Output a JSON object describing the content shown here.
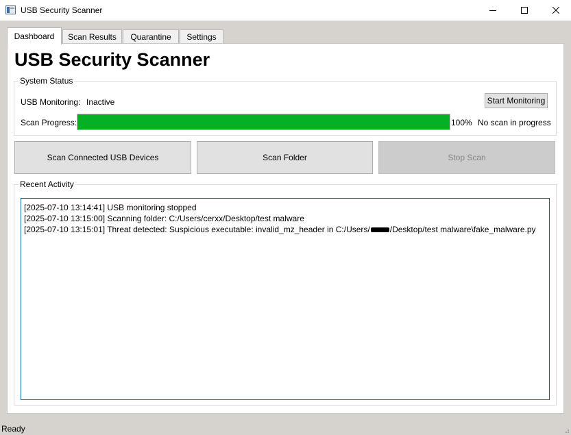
{
  "window": {
    "title": "USB Security Scanner"
  },
  "tabs": [
    {
      "label": "Dashboard",
      "active": true
    },
    {
      "label": "Scan Results",
      "active": false
    },
    {
      "label": "Quarantine",
      "active": false
    },
    {
      "label": "Settings",
      "active": false
    }
  ],
  "dashboard": {
    "heading": "USB Security Scanner",
    "system_status": {
      "title": "System Status",
      "monitoring_label": "USB Monitoring:",
      "monitoring_value": "Inactive",
      "start_button": "Start Monitoring",
      "progress_label": "Scan Progress:",
      "progress_percent": 100,
      "progress_text": "100%",
      "progress_status": "No scan in progress"
    },
    "actions": {
      "scan_usb": "Scan Connected USB Devices",
      "scan_folder": "Scan Folder",
      "stop_scan": "Stop Scan",
      "stop_enabled": false
    },
    "recent_activity": {
      "title": "Recent Activity",
      "lines": [
        "[2025-07-10 13:14:41] USB monitoring stopped",
        "[2025-07-10 13:15:00] Scanning folder: C:/Users/cerxx/Desktop/test malware",
        {
          "before": "[2025-07-10 13:15:01] Threat detected: Suspicious executable: invalid_mz_header in C:/Users/",
          "after": "/Desktop/test malware\\fake_malware.py"
        }
      ]
    }
  },
  "statusbar": {
    "text": "Ready"
  },
  "colors": {
    "progress_fill": "#06b025",
    "log_border": "#0a64a4",
    "window_background": "#d6d3ce"
  }
}
